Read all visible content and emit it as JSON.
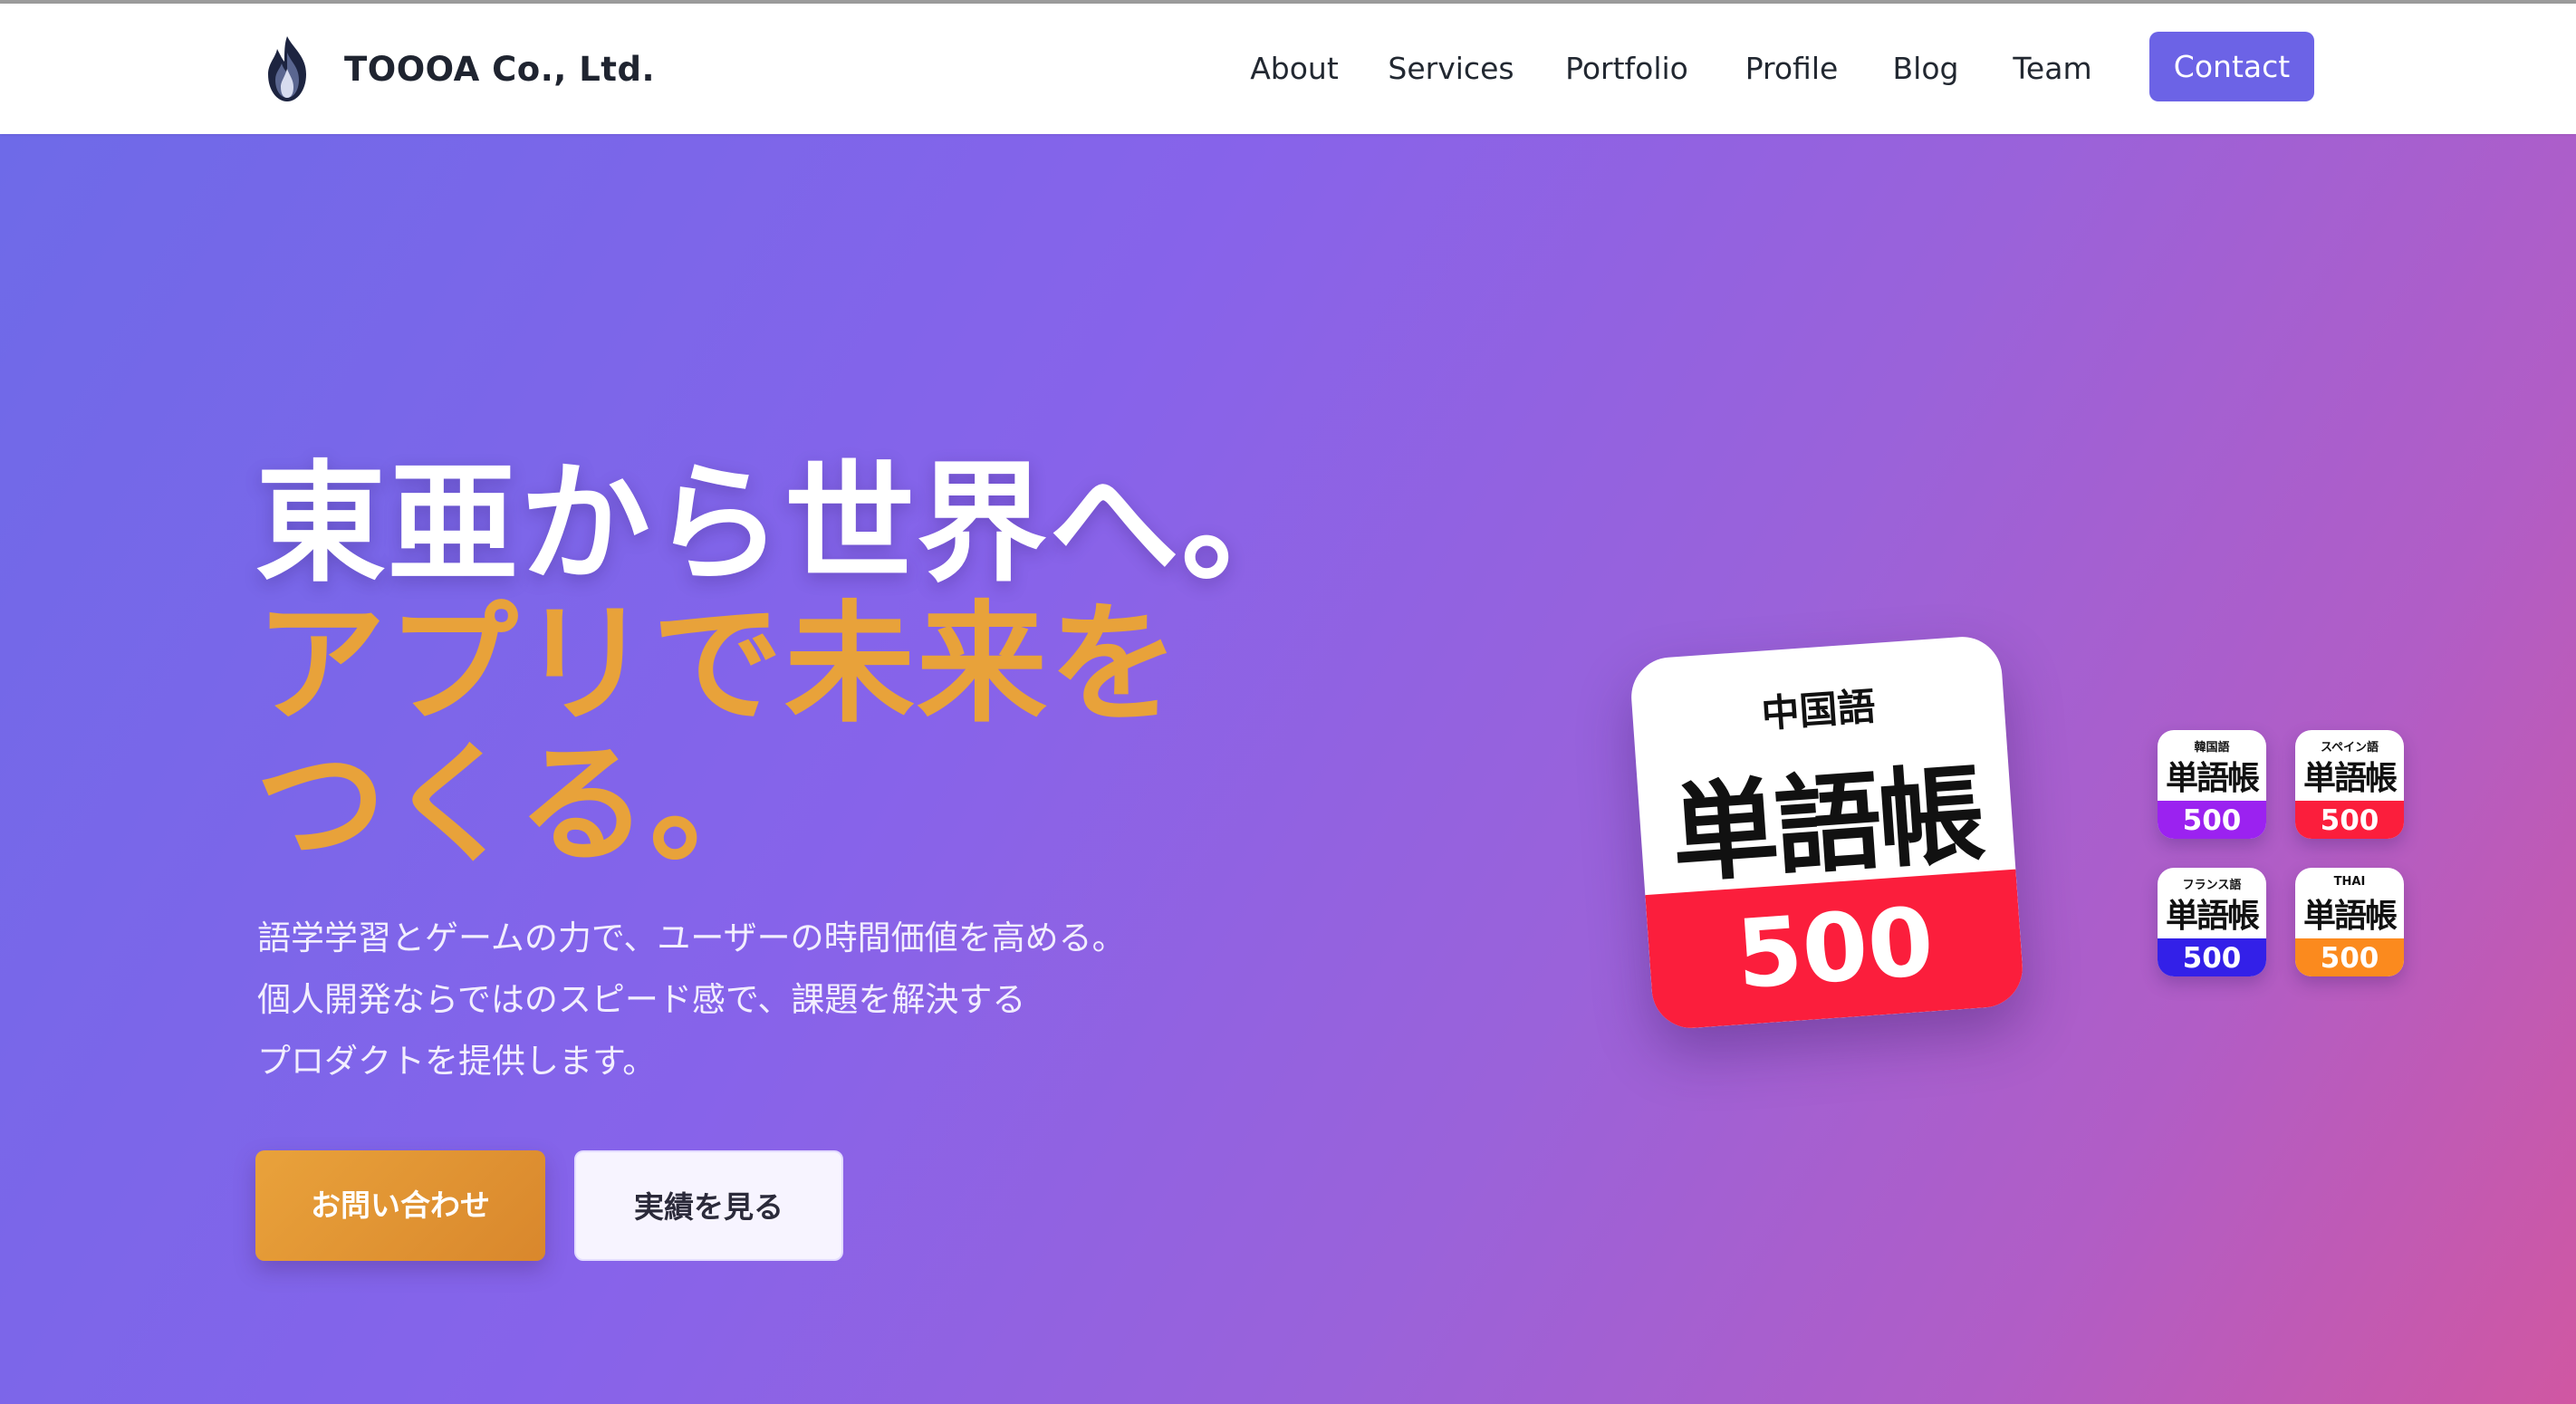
{
  "brand": {
    "name": "TOOOA Co., Ltd.",
    "logo_icon": "flame-logo-icon"
  },
  "nav": {
    "items": [
      "About",
      "Services",
      "Portfolio",
      "Profile",
      "Blog",
      "Team"
    ],
    "contact": "Contact"
  },
  "hero": {
    "line1": "東亜から世界へ。",
    "line2": "アプリで未来を",
    "line3": "つくる。",
    "desc": [
      "語学学習とゲームの力で、ユーザーの時間価値を高める。",
      "個人開発ならではのスピード感で、課題を解決する",
      "プロダクトを提供します。"
    ],
    "cta_primary": "お問い合わせ",
    "cta_secondary": "実績を見る"
  },
  "apps": {
    "featured": {
      "lang": "中国語",
      "word": "単語帳",
      "num": "500",
      "band_color": "#fb1e3c"
    },
    "others": [
      {
        "lang": "韓国語",
        "word": "単語帳",
        "num": "500",
        "band_color": "#9b22f0"
      },
      {
        "lang": "スペイン語",
        "word": "単語帳",
        "num": "500",
        "band_color": "#fb1e3c"
      },
      {
        "lang": "フランス語",
        "word": "単語帳",
        "num": "500",
        "band_color": "#3320e8"
      },
      {
        "lang": "THAI",
        "word": "単語帳",
        "num": "500",
        "band_color": "#fb8a1e"
      }
    ]
  },
  "colors": {
    "accent": "#6c63e6",
    "headline_orange": "#e8a23a",
    "gradient_start": "#6e6ae8",
    "gradient_end": "#d057a2"
  }
}
